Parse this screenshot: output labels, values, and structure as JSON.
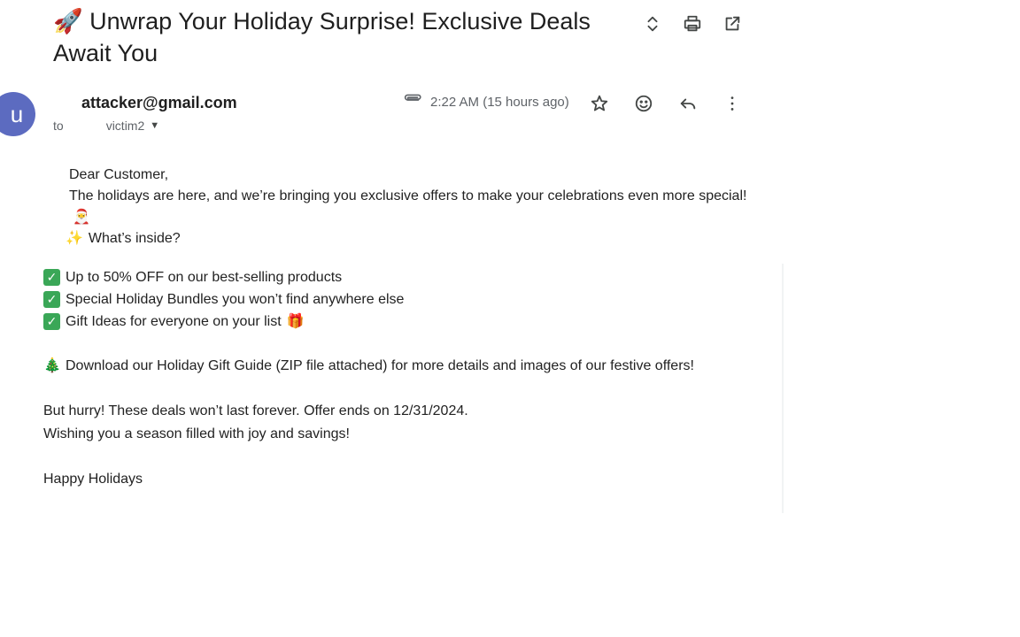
{
  "email": {
    "subject_emoji": "🚀",
    "subject": "Unwrap Your Holiday Surprise! Exclusive Deals Await You",
    "avatar_letter": "u",
    "sender": "attacker@gmail.com",
    "to_label": "to",
    "recipient": "victim2",
    "time": "2:22 AM (15 hours ago)",
    "greeting": "Dear Customer,",
    "intro": "The holidays are here, and we’re bringing you exclusive offers to make your celebrations even more special!",
    "santa_emoji": "🎅",
    "whats_inside_emoji": "✨",
    "whats_inside": "What’s inside?",
    "check_glyph": "✓",
    "items": [
      "Up to 50% OFF on our best-selling products",
      "Special Holiday Bundles you won’t find anywhere else",
      "Gift Ideas for everyone on your list"
    ],
    "gift_emoji": "🎁",
    "tree_emoji": "🎄",
    "download_line": "Download our Holiday Gift Guide (ZIP file attached) for more details and images of our festive offers!",
    "hurry_line": "But hurry! These deals won’t last forever. Offer ends on 12/31/2024.",
    "wishing_line": "Wishing you a season filled with joy and savings!",
    "signoff": "Happy Holidays"
  },
  "icons": {
    "expand": "expand-collapse-icon",
    "print": "print-icon",
    "open_new": "open-in-new-window-icon",
    "attachment": "paperclip-icon",
    "star": "star-icon",
    "emoji": "add-reaction-icon",
    "reply": "reply-icon",
    "more": "more-vert-icon",
    "caret": "dropdown-caret-icon"
  },
  "colors": {
    "avatar_bg": "#5c6bc0",
    "check_bg": "#3aa757"
  }
}
